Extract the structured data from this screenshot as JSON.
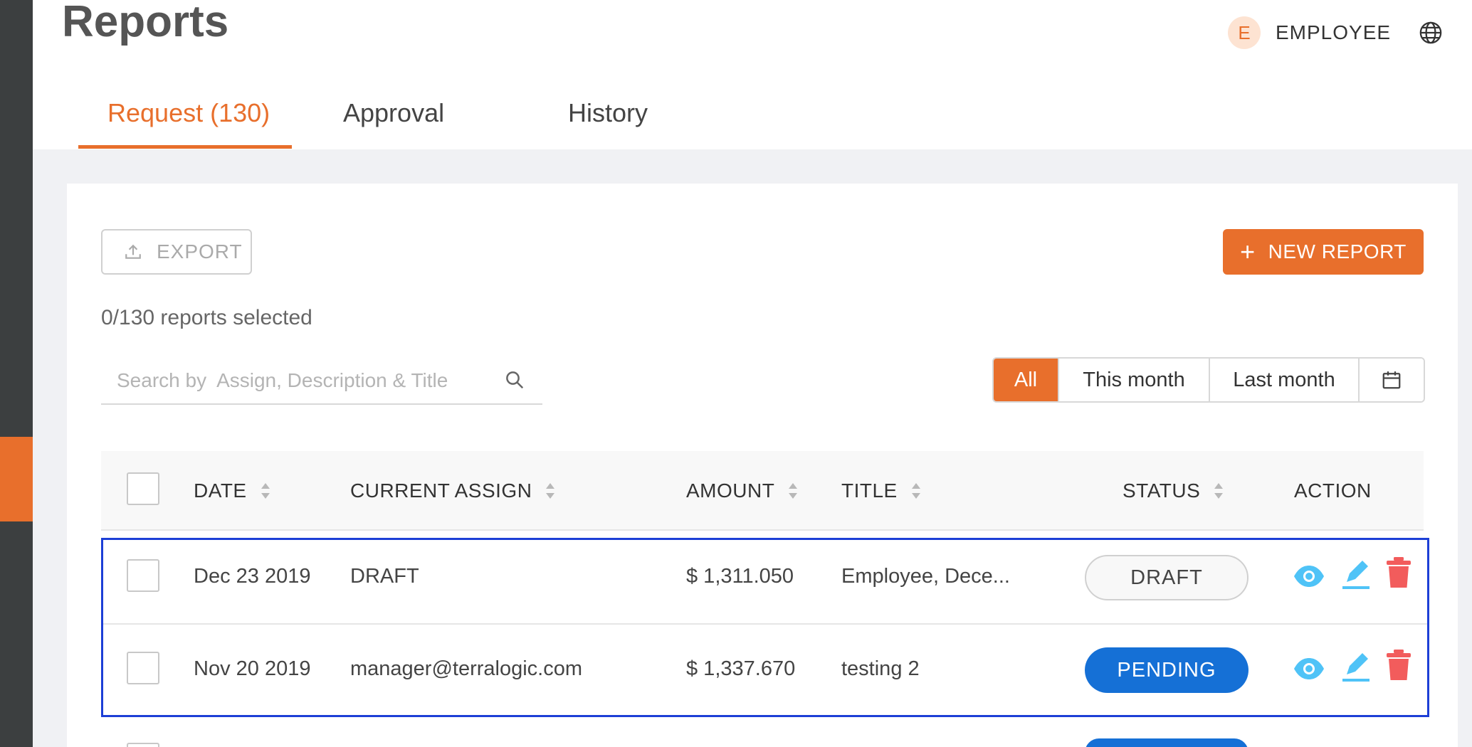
{
  "header": {
    "title": "Reports",
    "user": {
      "avatar_letter": "E",
      "role": "EMPLOYEE"
    }
  },
  "tabs": [
    {
      "label": "Request (130)",
      "active": true
    },
    {
      "label": "Approval",
      "active": false
    },
    {
      "label": "History",
      "active": false
    }
  ],
  "toolbar": {
    "export_label": "EXPORT",
    "new_report_label": "NEW REPORT",
    "selected_text": "0/130 reports selected"
  },
  "search": {
    "placeholder": "Search by  Assign, Description & Title",
    "value": ""
  },
  "filters": [
    {
      "label": "All",
      "active": true
    },
    {
      "label": "This month",
      "active": false
    },
    {
      "label": "Last month",
      "active": false
    }
  ],
  "table": {
    "columns": [
      "DATE",
      "CURRENT ASSIGN",
      "AMOUNT",
      "TITLE",
      "STATUS",
      "ACTION"
    ],
    "rows": [
      {
        "date": "Dec 23 2019",
        "assign": "DRAFT",
        "amount": "$ 1,311.050",
        "title": "Employee, Dece...",
        "status": "DRAFT"
      },
      {
        "date": "Nov 20 2019",
        "assign": "manager@terralogic.com",
        "amount": "$ 1,337.670",
        "title": "testing 2",
        "status": "PENDING"
      }
    ]
  },
  "colors": {
    "accent": "#e86f2c",
    "sidebar": "#3c3f40",
    "pending": "#1570d6",
    "view_icon": "#4fc3f7",
    "edit_icon": "#4fc3f7",
    "delete_icon": "#f25c5c",
    "selection_frame": "#1d3fd6"
  }
}
